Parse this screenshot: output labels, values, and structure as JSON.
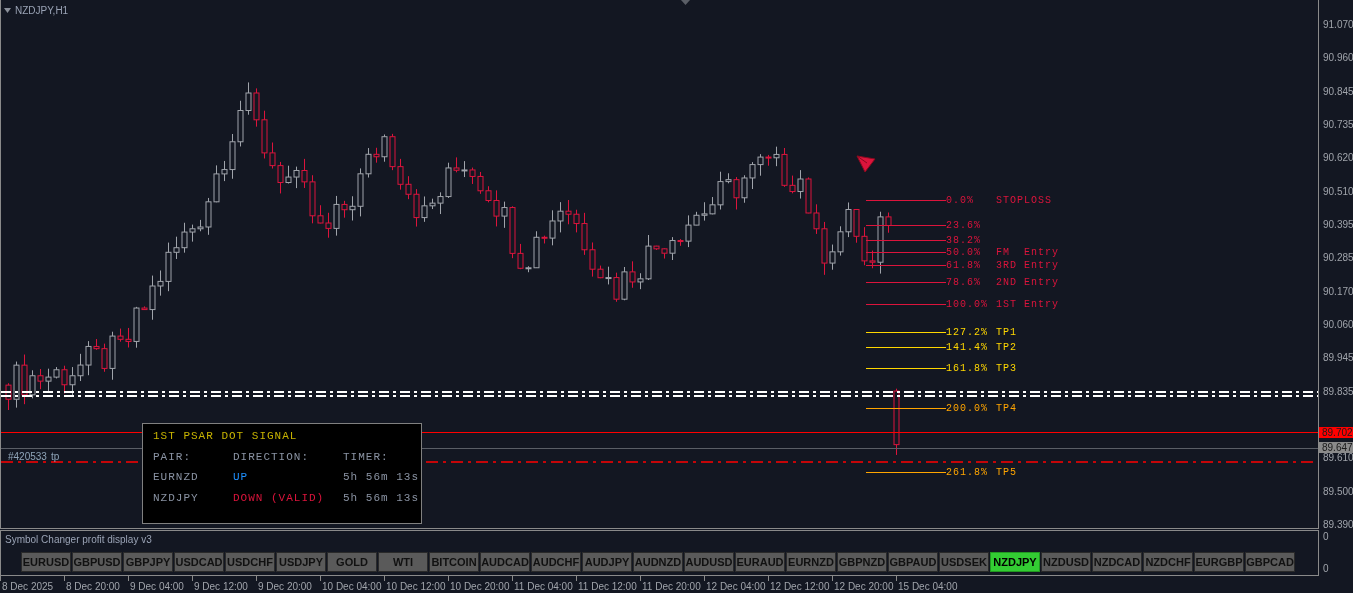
{
  "chart": {
    "title": "NZDJPY,H1",
    "price_axis": [
      "91.070",
      "90.960",
      "90.845",
      "90.735",
      "90.620",
      "90.510",
      "90.395",
      "90.285",
      "90.170",
      "90.060",
      "89.945",
      "89.835",
      "89.610",
      "89.500",
      "89.390"
    ],
    "price_tags": [
      {
        "text": "89.702",
        "color": "#ff0000"
      },
      {
        "text": "89.647",
        "color": "#8a8a8a"
      }
    ],
    "time_axis": [
      "8 Dec 2025",
      "8 Dec 20:00",
      "9 Dec 04:00",
      "9 Dec 12:00",
      "9 Dec 20:00",
      "10 Dec 04:00",
      "10 Dec 12:00",
      "10 Dec 20:00",
      "11 Dec 04:00",
      "11 Dec 12:00",
      "11 Dec 20:00",
      "12 Dec 04:00",
      "12 Dec 12:00",
      "12 Dec 20:00",
      "15 Dec 04:00"
    ],
    "fib_levels": [
      {
        "percent": "0.0%",
        "label": "STOPLOSS",
        "color": "#dc143c"
      },
      {
        "percent": "23.6%",
        "color": "#dc143c"
      },
      {
        "percent": "38.2%",
        "color": "#dc143c"
      },
      {
        "percent": "50.0%",
        "label": "FM  Entry",
        "color": "#dc143c"
      },
      {
        "percent": "61.8%",
        "label": "3RD Entry",
        "color": "#dc143c"
      },
      {
        "percent": "78.6%",
        "label": "2ND Entry",
        "color": "#dc143c"
      },
      {
        "percent": "100.0%",
        "label": "1ST Entry",
        "color": "#dc143c"
      },
      {
        "percent": "127.2%",
        "label": "TP1",
        "color": "#ffd700"
      },
      {
        "percent": "141.4%",
        "label": "TP2",
        "color": "#ffd700"
      },
      {
        "percent": "161.8%",
        "label": "TP3",
        "color": "#ffd700"
      },
      {
        "percent": "200.0%",
        "label": "TP4",
        "color": "#ffa500"
      },
      {
        "percent": "261.8%",
        "label": "TP5",
        "color": "#ffa500"
      }
    ],
    "trade_label": {
      "ticket": "#420533",
      "tag": "tp"
    }
  },
  "signal_panel": {
    "title": "1ST PSAR DOT SIGNAL",
    "headers": [
      "PAIR:",
      "DIRECTION:",
      "TIMER:"
    ],
    "rows": [
      {
        "pair": "EURNZD",
        "direction": "UP",
        "color": "#1e90ff",
        "timer": "5h 56m 13s"
      },
      {
        "pair": "NZDJPY",
        "direction": "DOWN (VALID)",
        "color": "#dc143c",
        "timer": "5h 56m 13s"
      }
    ]
  },
  "indicator": {
    "title": "Symbol Changer profit display v3",
    "axis": [
      "0",
      "0"
    ],
    "buttons": [
      {
        "label": "EURUSD",
        "selected": false
      },
      {
        "label": "GBPUSD",
        "selected": false
      },
      {
        "label": "GBPJPY",
        "selected": false
      },
      {
        "label": "USDCAD",
        "selected": false
      },
      {
        "label": "USDCHF",
        "selected": false
      },
      {
        "label": "USDJPY",
        "selected": false
      },
      {
        "label": "GOLD",
        "selected": false
      },
      {
        "label": "WTI",
        "selected": false
      },
      {
        "label": "BITCOIN",
        "selected": false
      },
      {
        "label": "AUDCAD",
        "selected": false
      },
      {
        "label": "AUDCHF",
        "selected": false
      },
      {
        "label": "AUDJPY",
        "selected": false
      },
      {
        "label": "AUDNZD",
        "selected": false
      },
      {
        "label": "AUDUSD",
        "selected": false
      },
      {
        "label": "EURAUD",
        "selected": false
      },
      {
        "label": "EURNZD",
        "selected": false
      },
      {
        "label": "GBPNZD",
        "selected": false
      },
      {
        "label": "GBPAUD",
        "selected": false
      },
      {
        "label": "USDSEK",
        "selected": false
      },
      {
        "label": "NZDJPY",
        "selected": true
      },
      {
        "label": "NZDUSD",
        "selected": false
      },
      {
        "label": "NZDCAD",
        "selected": false
      },
      {
        "label": "NZDCHF",
        "selected": false
      },
      {
        "label": "EURGBP",
        "selected": false
      },
      {
        "label": "GBPCAD",
        "selected": false
      }
    ]
  }
}
